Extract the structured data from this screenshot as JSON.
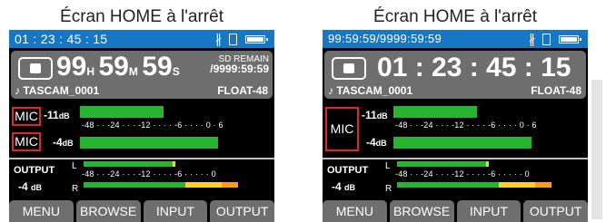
{
  "captions": {
    "left": "Écran HOME à l'arrêt",
    "right": "Écran HOME à l'arrêt"
  },
  "left_screen": {
    "topbar_time": "01 : 23 : 45 : 15",
    "counter_h": "99",
    "unit_h": "H",
    "counter_m": "59",
    "unit_m": "M",
    "counter_s": "59",
    "unit_s": "S",
    "sd_label": "SD REMAIN",
    "sd_value": "/9999:59:59",
    "file_name": "♪ TASCAM_0001",
    "format": "FLOAT-48",
    "mic1_label": "MIC",
    "mic1_level": "-11",
    "mic2_label": "MIC",
    "mic2_level": "-4",
    "db_unit": "dB",
    "input_scale": "-48 · · -24 · · · -12 · · · · -6 · · · · 0 · 6",
    "input_levels": [
      0.42,
      0.85
    ],
    "output_label": "OUTPUT",
    "output_level": "-4",
    "output_L": "L",
    "output_R": "R",
    "output_scale": "-48 · · -24 · · · -12 · · · · -6 · · · · · 0"
  },
  "right_screen": {
    "topbar_time": "99:59:59/9999:59:59",
    "counter": "01 : 23 : 45 : 15",
    "file_name": "♪ TASCAM_0001",
    "format": "FLOAT-48",
    "mic_label": "MIC",
    "mic1_level": "-11",
    "mic2_level": "-4",
    "db_unit": "dB",
    "input_scale": "-48 · · -24 · · · -12 · · · · -6 · · · · 0 · 6",
    "output_label": "OUTPUT",
    "output_level": "-4",
    "output_L": "L",
    "output_R": "R",
    "output_scale": "-48 · · -24 · · · -12 · · · · -6 · · · · · 0"
  },
  "buttons": [
    "MENU",
    "BROWSE",
    "INPUT",
    "OUTPUT"
  ],
  "icons": [
    "bluetooth-icon",
    "sd-card-icon",
    "battery-icon",
    "stop-icon"
  ],
  "colors": {
    "topbar": "#1777c4",
    "meter_green": "#27b52f",
    "meter_yellow": "#ffd21f",
    "meter_orange": "#ff9a1a",
    "mic_box": "#e02626",
    "panel": "#6e6e6e"
  }
}
